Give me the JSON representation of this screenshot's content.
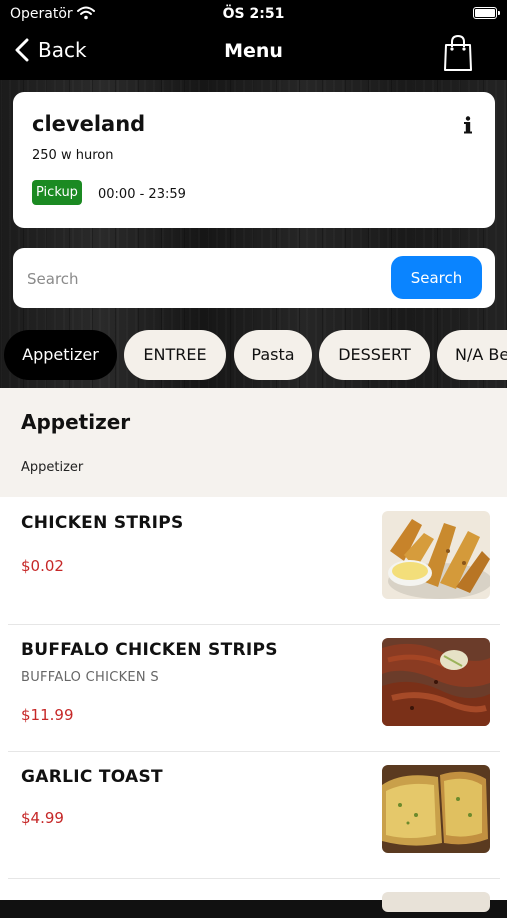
{
  "status": {
    "carrier": "Operatör",
    "time": "ÖS 2:51"
  },
  "nav": {
    "back_label": "Back",
    "title": "Menu"
  },
  "store": {
    "name": "cleveland",
    "address": "250 w huron",
    "mode_badge": "Pickup",
    "hours": "00:00 - 23:59"
  },
  "search": {
    "placeholder": "Search",
    "value": "",
    "button_label": "Search"
  },
  "tabs": [
    "Appetizer",
    "ENTREE",
    "Pasta",
    "DESSERT",
    "N/A Be"
  ],
  "active_tab": "Appetizer",
  "section": {
    "title": "Appetizer",
    "subtitle": "Appetizer"
  },
  "items": [
    {
      "name": "CHICKEN STRIPS",
      "description": "",
      "price": "$0.02",
      "image": "chicken-strips-photo"
    },
    {
      "name": "BUFFALO CHICKEN STRIPS",
      "description": "BUFFALO CHICKEN S",
      "price": "$11.99",
      "image": "buffalo-chicken-strips-photo"
    },
    {
      "name": "GARLIC TOAST",
      "description": "",
      "price": "$4.99",
      "image": "garlic-toast-photo"
    }
  ],
  "colors": {
    "accent_blue": "#0a84ff",
    "pickup_green": "#1b8a22",
    "price_red": "#c62828",
    "active_tab_bg": "#000000",
    "tab_bg": "#f4f0ea"
  }
}
